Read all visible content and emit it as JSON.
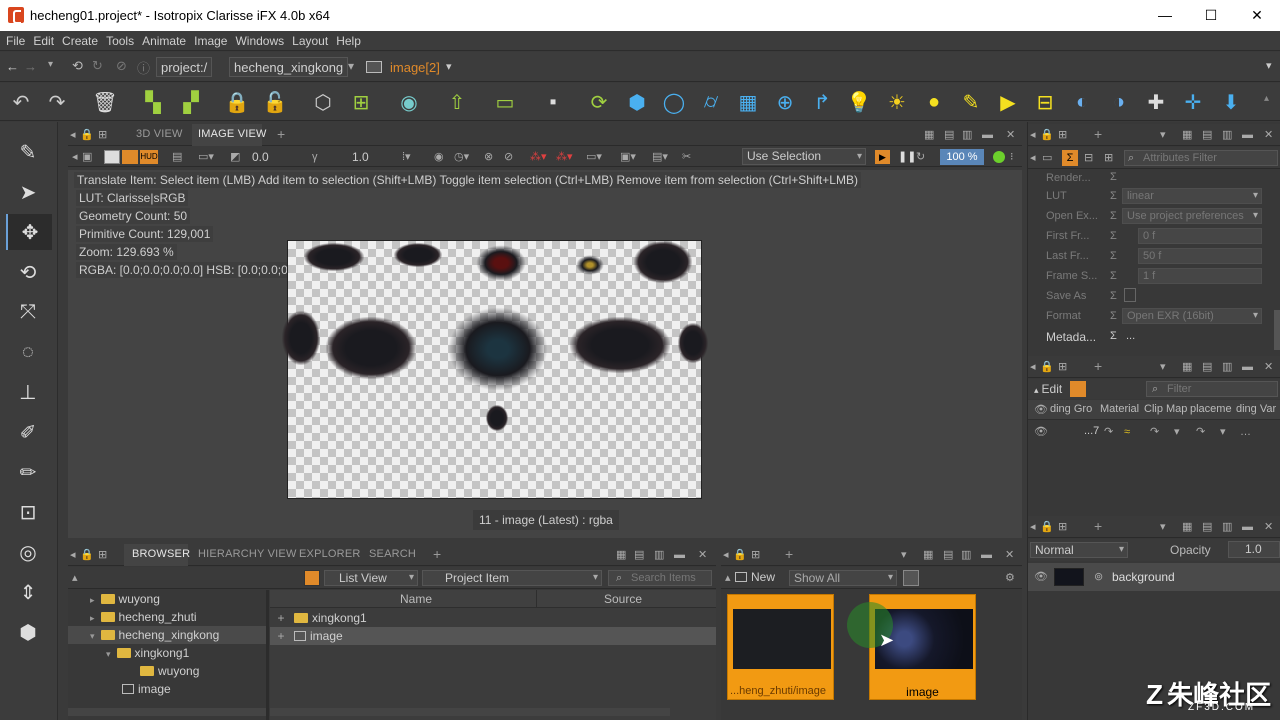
{
  "window": {
    "title": "hecheng01.project* - Isotropix Clarisse iFX 4.0b x64",
    "min": "—",
    "max": "☐",
    "close": "✕"
  },
  "menu": [
    "File",
    "Edit",
    "Create",
    "Tools",
    "Animate",
    "Image",
    "Windows",
    "Layout",
    "Help"
  ],
  "address": {
    "crumbs": [
      "project:/",
      "hecheng_xingkong",
      "image[2]"
    ]
  },
  "viewport": {
    "tabs": [
      "3D VIEW",
      "IMAGE VIEW"
    ],
    "add": "+",
    "exposure": "0.0",
    "gamma": "1.0",
    "selection_mode": "Use Selection",
    "zoom": "100 %",
    "hud": "HUD",
    "help_line": "Translate Item: Select item (LMB)  Add item to selection (Shift+LMB)  Toggle item selection (Ctrl+LMB)  Remove item from selection (Ctrl+Shift+LMB)",
    "lut": "LUT: Clarisse|sRGB",
    "geometry_count": "Geometry Count: 50",
    "primitive_count": "Primitive Count: 129,001",
    "zoom_info": "Zoom: 129.693 %",
    "rgba": "RGBA: [0.0;0.0;0.0;0.0] HSB: [0.0;0.0;0.0]",
    "caption": "11 - image (Latest) : rgba"
  },
  "browser": {
    "tabs": [
      "BROWSER",
      "HIERARCHY VIEW",
      "EXPLORER",
      "SEARCH"
    ],
    "view_mode": "List View",
    "item_type": "Project Item",
    "search_placeholder": "Search Items",
    "tree": [
      "wuyong",
      "hecheng_zhuti",
      "hecheng_xingkong",
      "xingkong1",
      "wuyong",
      "image"
    ],
    "columns": [
      "Name",
      "Source"
    ],
    "rows": [
      "xingkong1",
      "image"
    ]
  },
  "layers": {
    "new_label": "New",
    "filter": "Show All",
    "thumbs": [
      "...heng_zhuti/image",
      "image"
    ]
  },
  "attributes": {
    "filter_placeholder": "Attributes Filter",
    "rows": [
      {
        "label": "Render...",
        "value": ""
      },
      {
        "label": "LUT",
        "value": "linear"
      },
      {
        "label": "Open Ex...",
        "value": "Use project preferences"
      },
      {
        "label": "First Fr...",
        "value": "0 f"
      },
      {
        "label": "Last Fr...",
        "value": "50 f"
      },
      {
        "label": "Frame S...",
        "value": "1 f"
      },
      {
        "label": "Save As",
        "value": ""
      },
      {
        "label": "Format",
        "value": "Open EXR (16bit)"
      },
      {
        "label": "Metada...",
        "value": "..."
      }
    ]
  },
  "material": {
    "edit_label": "Edit",
    "filter_placeholder": "Filter",
    "columns": [
      "ding Gro",
      "Material",
      "Clip Map",
      "placeme",
      "ding Var"
    ],
    "row_val": "...7"
  },
  "layer_stack": {
    "blend": "Normal",
    "opacity_label": "Opacity",
    "opacity": "1.0",
    "item": "background"
  },
  "watermark": "朱峰社区",
  "watermark_sub": "ZF3D.COM"
}
